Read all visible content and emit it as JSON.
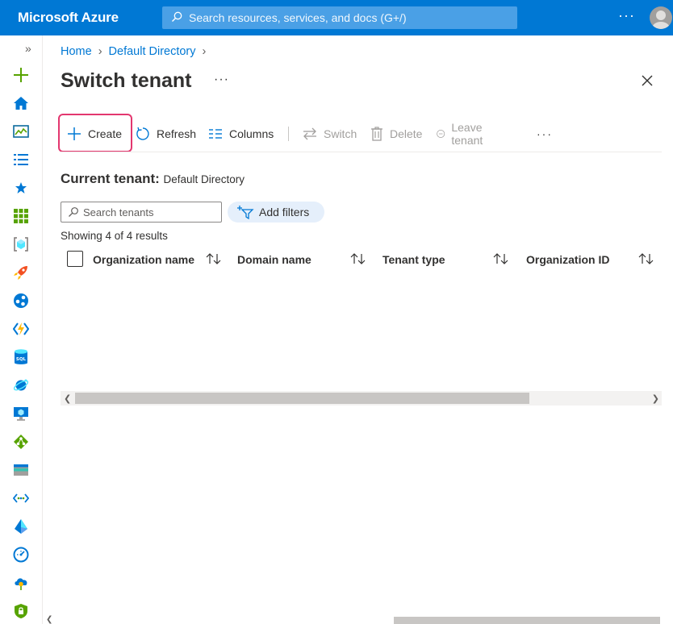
{
  "app": {
    "brand": "Microsoft Azure"
  },
  "topbar": {
    "search_placeholder": "Search resources, services, and docs (G+/)",
    "more_label": "···"
  },
  "rail": {
    "expand_label": "»",
    "items": [
      "create-resource",
      "home",
      "dashboard",
      "all-services",
      "favorites",
      "all-resources",
      "resource-groups",
      "quickstart",
      "app-services",
      "function-app",
      "sql-databases",
      "cosmos-db",
      "virtual-machines",
      "load-balancers",
      "storage-accounts",
      "virtual-networks",
      "azure-ad",
      "monitor",
      "advisor",
      "security-center"
    ]
  },
  "breadcrumb": {
    "home": "Home",
    "sep": "›",
    "directory": "Default Directory"
  },
  "page": {
    "title": "Switch tenant",
    "more_label": "···"
  },
  "toolbar": {
    "create": "Create",
    "refresh": "Refresh",
    "columns": "Columns",
    "switch": "Switch",
    "delete": "Delete",
    "leave": "Leave tenant",
    "more": "···"
  },
  "current": {
    "label": "Current tenant:",
    "value": "Default Directory"
  },
  "filter": {
    "placeholder": "Search tenants",
    "value": "",
    "add_filters": "Add filters"
  },
  "results": {
    "showing": "Showing 4 of 4 results"
  },
  "table": {
    "columns": [
      "Organization name",
      "Domain name",
      "Tenant type",
      "Organization ID"
    ],
    "rows": []
  },
  "colors": {
    "brand": "#0078d4",
    "highlight": "#e3376f",
    "filter_pill": "#e5effb"
  }
}
